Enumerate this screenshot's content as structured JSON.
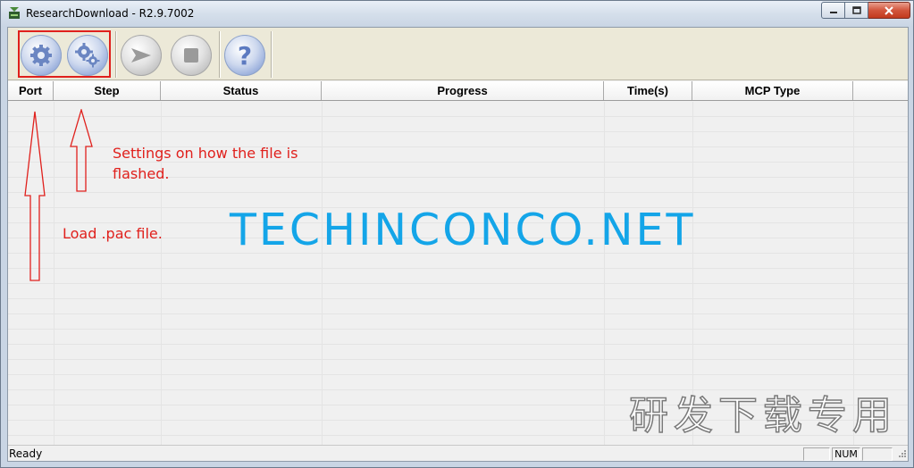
{
  "window": {
    "title": "ResearchDownload - R2.9.7002"
  },
  "toolbar": {
    "buttons": [
      {
        "icon": "gear-icon",
        "label": ""
      },
      {
        "icon": "gears-icon",
        "label": ""
      },
      {
        "icon": "play-arrow-icon",
        "label": ""
      },
      {
        "icon": "stop-icon",
        "label": ""
      },
      {
        "icon": "help-icon",
        "label": "?"
      }
    ]
  },
  "table": {
    "columns": [
      "Port",
      "Step",
      "Status",
      "Progress",
      "Time(s)",
      "MCP Type"
    ]
  },
  "annotations": {
    "settings_line1": "Settings on how the file is",
    "settings_line2": "flashed.",
    "load": "Load .pac file."
  },
  "watermarks": {
    "logo": "TECHINCONCO.NET",
    "cjk": "研发下载专用"
  },
  "statusbar": {
    "text": "Ready",
    "num": "NUM"
  },
  "colors": {
    "annotation": "#e0201c",
    "logo": "#14a5e8"
  }
}
